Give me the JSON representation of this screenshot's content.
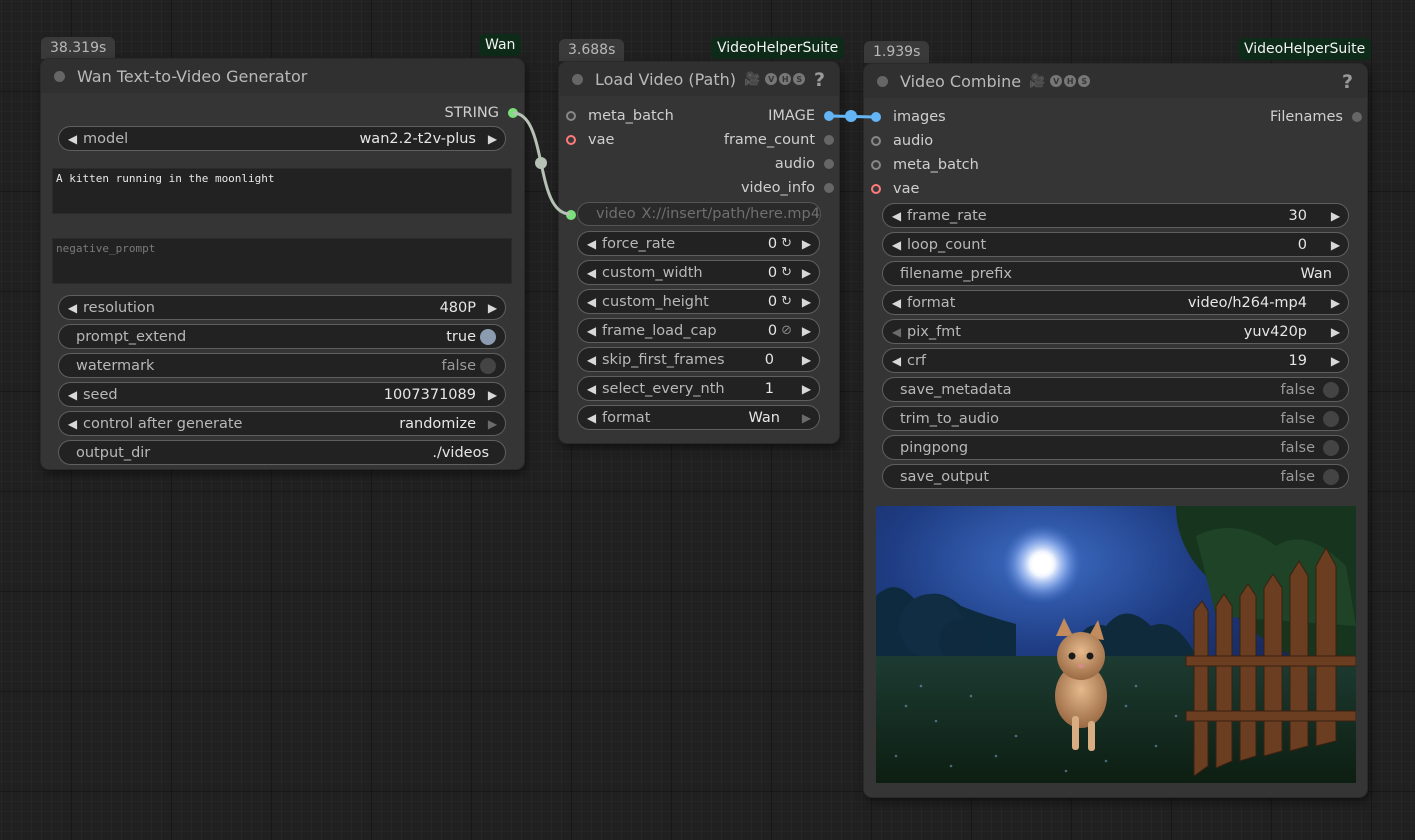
{
  "links": {
    "color_string": "#b5c2b4",
    "color_image": "#64b5f6"
  },
  "wan_node": {
    "time": "38.319s",
    "source": "Wan",
    "title": "Wan Text-to-Video Generator",
    "output_label": "STRING",
    "model": {
      "label": "model",
      "value": "wan2.2-t2v-plus"
    },
    "prompt": "A kitten running in the moonlight",
    "negative_prompt_placeholder": "negative_prompt",
    "resolution": {
      "label": "resolution",
      "value": "480P"
    },
    "prompt_extend": {
      "label": "prompt_extend",
      "value": "true"
    },
    "watermark": {
      "label": "watermark",
      "value": "false"
    },
    "seed": {
      "label": "seed",
      "value": "1007371089"
    },
    "control_after_generate": {
      "label": "control after generate",
      "value": "randomize"
    },
    "output_dir": {
      "label": "output_dir",
      "value": "./videos"
    }
  },
  "load_node": {
    "time": "3.688s",
    "source": "VideoHelperSuite",
    "title": "Load Video (Path)",
    "badge_emoji": "🎥",
    "badges": [
      "V",
      "H",
      "S"
    ],
    "help": "?",
    "inputs": [
      "meta_batch",
      "vae"
    ],
    "outputs": [
      "IMAGE",
      "frame_count",
      "audio",
      "video_info"
    ],
    "video": {
      "label": "video",
      "placeholder": "X://insert/path/here.mp4"
    },
    "widgets": [
      {
        "label": "force_rate",
        "value": "0",
        "icon": "↻"
      },
      {
        "label": "custom_width",
        "value": "0",
        "icon": "↻"
      },
      {
        "label": "custom_height",
        "value": "0",
        "icon": "↻"
      },
      {
        "label": "frame_load_cap",
        "value": "0",
        "icon": "⊘"
      },
      {
        "label": "skip_first_frames",
        "value": "0"
      },
      {
        "label": "select_every_nth",
        "value": "1"
      },
      {
        "label": "format",
        "value": "Wan"
      }
    ]
  },
  "combine_node": {
    "time": "1.939s",
    "source": "VideoHelperSuite",
    "title": "Video Combine",
    "badge_emoji": "🎥",
    "badges": [
      "V",
      "H",
      "S"
    ],
    "help": "?",
    "inputs": [
      "images",
      "audio",
      "meta_batch",
      "vae"
    ],
    "output": "Filenames",
    "frame_rate": {
      "label": "frame_rate",
      "value": "30"
    },
    "loop_count": {
      "label": "loop_count",
      "value": "0"
    },
    "filename_prefix": {
      "label": "filename_prefix",
      "value": "Wan"
    },
    "format": {
      "label": "format",
      "value": "video/h264-mp4"
    },
    "pix_fmt": {
      "label": "pix_fmt",
      "value": "yuv420p"
    },
    "crf": {
      "label": "crf",
      "value": "19"
    },
    "save_metadata": {
      "label": "save_metadata",
      "value": "false"
    },
    "trim_to_audio": {
      "label": "trim_to_audio",
      "value": "false"
    },
    "pingpong": {
      "label": "pingpong",
      "value": "false"
    },
    "save_output": {
      "label": "save_output",
      "value": "false"
    }
  }
}
